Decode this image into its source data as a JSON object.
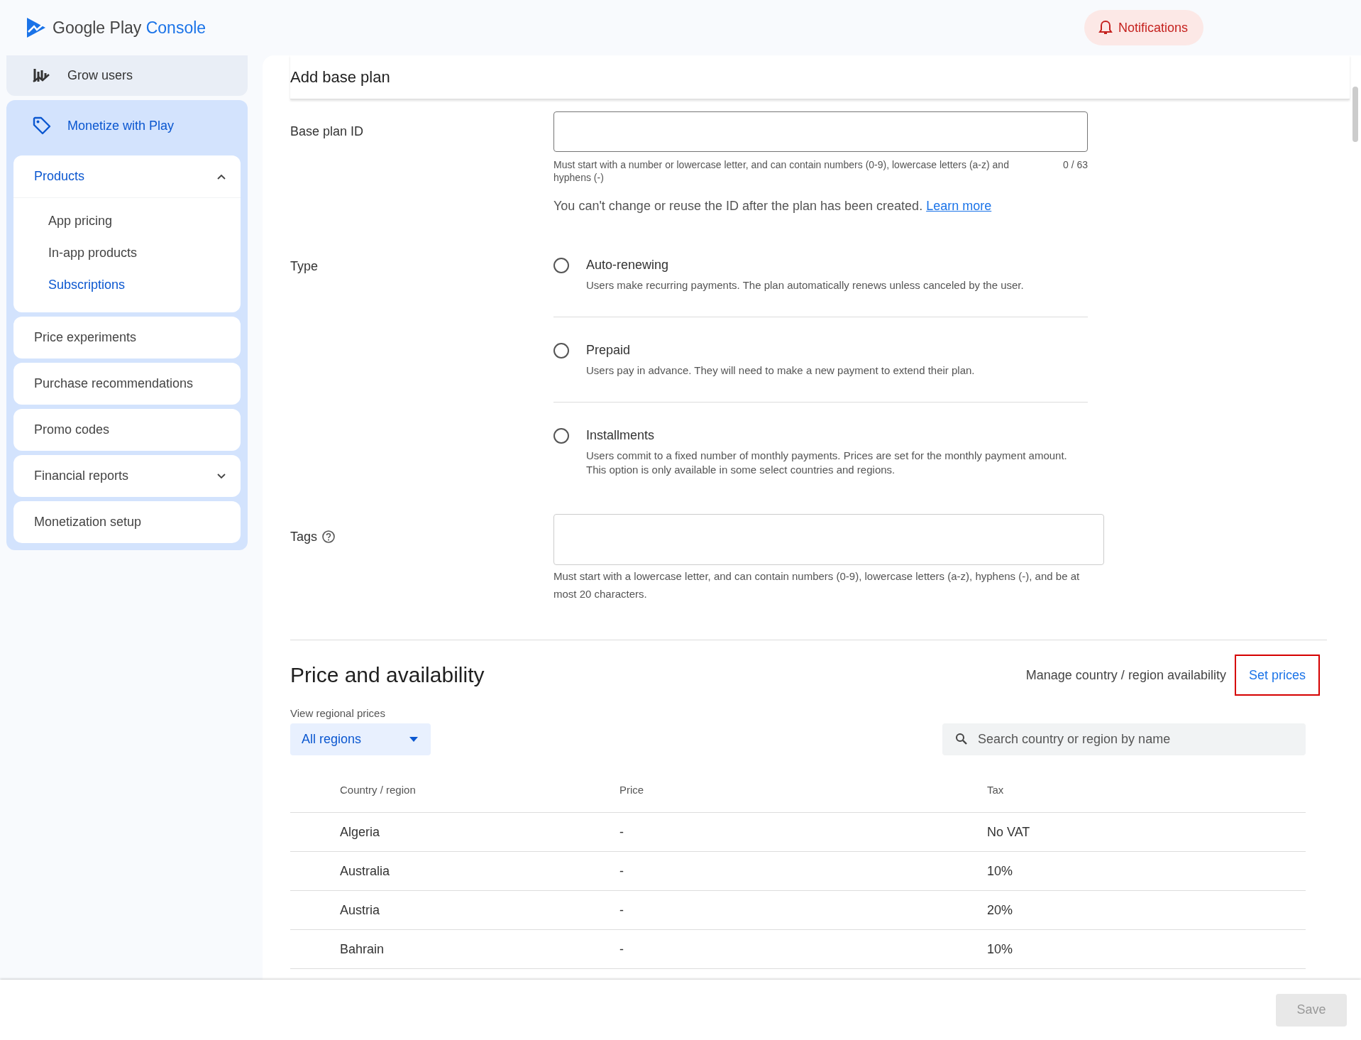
{
  "header": {
    "logo_text": "Google Play",
    "logo_accent": "Console",
    "notifications": "Notifications"
  },
  "sidebar": {
    "grow_users": {
      "label": "Grow users",
      "selected": false
    },
    "monetize": {
      "label": "Monetize with Play",
      "selected": true,
      "items": [
        {
          "label": "Products",
          "kind": "expandable",
          "expanded": true,
          "selected": true,
          "children": [
            {
              "label": "App pricing",
              "selected": false
            },
            {
              "label": "In-app products",
              "selected": false
            },
            {
              "label": "Subscriptions",
              "selected": true
            }
          ]
        },
        {
          "label": "Price experiments",
          "kind": "link",
          "selected": false
        },
        {
          "label": "Purchase recommendations",
          "kind": "link",
          "selected": false
        },
        {
          "label": "Promo codes",
          "kind": "link",
          "selected": false
        },
        {
          "label": "Financial reports",
          "kind": "expandable",
          "expanded": false,
          "selected": false
        },
        {
          "label": "Monetization setup",
          "kind": "link",
          "selected": false
        }
      ]
    }
  },
  "form": {
    "title": "Add base plan",
    "base_plan_id": {
      "label": "Base plan ID",
      "helper": "Must start with a number or lowercase letter, and can contain numbers (0-9), lowercase letters (a-z) and hyphens (-)",
      "counter": "0 / 63",
      "note": "You can't change or reuse the ID after the plan has been created.",
      "link": "Learn more"
    },
    "type": {
      "label": "Type",
      "options": [
        {
          "label": "Auto-renewing",
          "description": "Users make recurring payments. The plan automatically renews unless canceled by the user.",
          "selected": false
        },
        {
          "label": "Prepaid",
          "description": "Users pay in advance. They will need to make a new payment to extend their plan.",
          "selected": false
        },
        {
          "label": "Installments",
          "description": "Users commit to a fixed number of monthly payments. Prices are set for the monthly payment amount. This option is only available in some select countries and regions.",
          "selected": false
        }
      ]
    },
    "tags": {
      "label": "Tags",
      "helper": "Must start with a lowercase letter, and can contain numbers (0-9), lowercase letters (a-z), hyphens (-), and be at most 20 characters."
    }
  },
  "pricing": {
    "title": "Price and availability",
    "manage_link": "Manage country / region availability",
    "set_prices": {
      "label": "Set prices",
      "outlined": true
    },
    "region_filter": {
      "label": "View regional prices",
      "value": "All regions"
    },
    "search": {
      "placeholder": "Search country or region by name"
    },
    "table": {
      "columns": [
        "Country / region",
        "Price",
        "Tax"
      ],
      "rows": [
        [
          "Algeria",
          "-",
          "No VAT"
        ],
        [
          "Australia",
          "-",
          "10%"
        ],
        [
          "Austria",
          "-",
          "20%"
        ],
        [
          "Bahrain",
          "-",
          "10%"
        ]
      ]
    }
  },
  "footer": {
    "save": {
      "label": "Save",
      "disabled": true
    }
  }
}
